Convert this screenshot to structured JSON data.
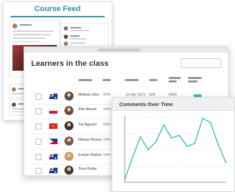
{
  "course_feed": {
    "title": "Course Feed"
  },
  "learners_table": {
    "title": "Learners in the class",
    "rows": [
      {
        "flag": "australia-flag",
        "name": "Midwal John",
        "percent": "54%",
        "date": "10 Apr 2021",
        "status": "N/A",
        "code": "4999",
        "has_pill": true,
        "avatar_color": "#5a4a42"
      },
      {
        "flag": "poland-flag",
        "name": "Alm Akbad",
        "percent": "54%",
        "date": "",
        "status": "",
        "code": "",
        "has_pill": false,
        "avatar_color": "#6b4a3a"
      },
      {
        "flag": "vietnam-flag",
        "name": "Tai Nguyen",
        "percent": "54%",
        "date": "",
        "status": "",
        "code": "",
        "has_pill": false,
        "avatar_color": "#3d2f2a"
      },
      {
        "flag": "philippines-flag",
        "name": "Marian Rivera",
        "percent": "54%",
        "date": "",
        "status": "",
        "code": "",
        "has_pill": false,
        "avatar_color": "#7a5442"
      },
      {
        "flag": "australia-flag",
        "name": "Evelyn Parker",
        "percent": "54%",
        "date": "",
        "status": "",
        "code": "",
        "has_pill": false,
        "avatar_color": "#c79a6e"
      },
      {
        "flag": "australia-flag",
        "name": "Tony Butler",
        "percent": "",
        "date": "",
        "status": "",
        "code": "",
        "has_pill": false,
        "avatar_color": "#4a3a33"
      }
    ]
  },
  "comments_chart": {
    "title": "Comments Over Time"
  },
  "chart_data": {
    "type": "line",
    "title": "Comments Over Time",
    "xlabel": "",
    "ylabel": "",
    "grid": true,
    "x": [
      1,
      2,
      3,
      4,
      5,
      6,
      7,
      8,
      9,
      10,
      11,
      12,
      13,
      14
    ],
    "values": [
      5,
      38,
      70,
      50,
      62,
      88,
      68,
      72,
      55,
      60,
      98,
      92,
      58,
      30
    ],
    "ylim": [
      0,
      100
    ],
    "series_color": "#3bbcb7"
  }
}
